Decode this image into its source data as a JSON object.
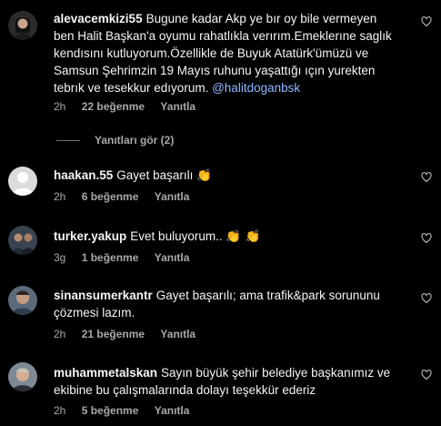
{
  "comments": [
    {
      "username": "alevacemkizi55",
      "text": "Bugune kadar Akp ye bır oy bile vermeyen ben Halit Başkan'a oyumu rahatlıkla verırım.Emeklerıne saglık kendısını kutluyorum.Özellikle de Buyuk Atatürk'ümüzü ve Samsun Şehrimzin 19 Mayıs ruhunu yaşattığı ıçın yurekten tebrık ve tesekkur edıyorum.",
      "mention": "@halitdoganbsk",
      "time": "2h",
      "likes": "22 beğenme",
      "reply": "Yanıtla"
    },
    {
      "username": "haakan.55",
      "text": "Gayet başarılı",
      "emoji": "👏",
      "time": "2h",
      "likes": "6 beğenme",
      "reply": "Yanıtla"
    },
    {
      "username": "turker.yakup",
      "text": "Evet buluyorum..",
      "emoji": "👏 👏",
      "time": "3g",
      "likes": "1 beğenme",
      "reply": "Yanıtla"
    },
    {
      "username": "sinansumerkantr",
      "text": "Gayet başarılı; ama trafik&park sorununu çözmesi lazım.",
      "time": "2h",
      "likes": "21 beğenme",
      "reply": "Yanıtla"
    },
    {
      "username": "muhammetalskan",
      "text": "Sayın büyük şehir belediye başkanımız ve ekibine bu çalışmalarında dolayı teşekkür ederiz",
      "time": "2h",
      "likes": "5 beğenme",
      "reply": "Yanıtla"
    }
  ],
  "replies_toggle": "Yanıtları gör (2)",
  "icons": [
    "avatar",
    "heart-icon"
  ],
  "colors": {
    "background": "#000000",
    "text": "#f5f5f5",
    "muted": "#a8a8a8",
    "mention": "#8fb7ff"
  }
}
